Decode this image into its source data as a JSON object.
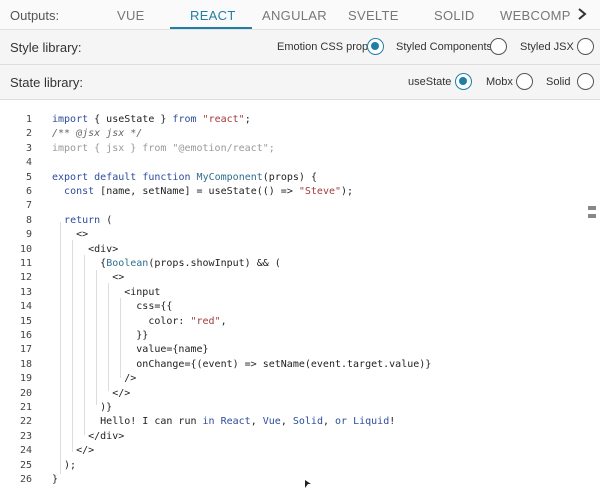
{
  "outputs": {
    "label": "Outputs:",
    "tabs": [
      "VUE",
      "REACT",
      "ANGULAR",
      "SVELTE",
      "SOLID",
      "WEBCOMPONENTS"
    ],
    "active_tab": "REACT",
    "accent_color": "#1f7fa6"
  },
  "style_library": {
    "label": "Style library:",
    "options": [
      {
        "label": "Emotion CSS prop",
        "selected": true
      },
      {
        "label": "Styled Components",
        "selected": false
      },
      {
        "label": "Styled JSX",
        "selected": false
      }
    ]
  },
  "state_library": {
    "label": "State library:",
    "options": [
      {
        "label": "useState",
        "selected": true
      },
      {
        "label": "Mobx",
        "selected": false
      },
      {
        "label": "Solid",
        "selected": false
      }
    ]
  },
  "code": {
    "line_numbers": [
      "1",
      "2",
      "3",
      "4",
      "5",
      "6",
      "7",
      "8",
      "9",
      "10",
      "11",
      "12",
      "13",
      "14",
      "15",
      "16",
      "17",
      "18",
      "19",
      "20",
      "21",
      "22",
      "23",
      "24",
      "25",
      "26"
    ],
    "lines": [
      "import { useState } from \"react\";",
      "/** @jsx jsx */",
      "import { jsx } from \"@emotion/react\";",
      "",
      "export default function MyComponent(props) {",
      "  const [name, setName] = useState(() => \"Steve\");",
      "",
      "  return (",
      "    <>",
      "      <div>",
      "        {Boolean(props.showInput) && (",
      "          <>",
      "            <input",
      "              css={{",
      "                color: \"red\",",
      "              }}",
      "              value={name}",
      "              onChange={(event) => setName(event.target.value)}",
      "            />",
      "          </>",
      "        )}",
      "        Hello! I can run in React, Vue, Solid, or Liquid!",
      "      </div>",
      "    </>",
      "  );",
      "}"
    ]
  }
}
